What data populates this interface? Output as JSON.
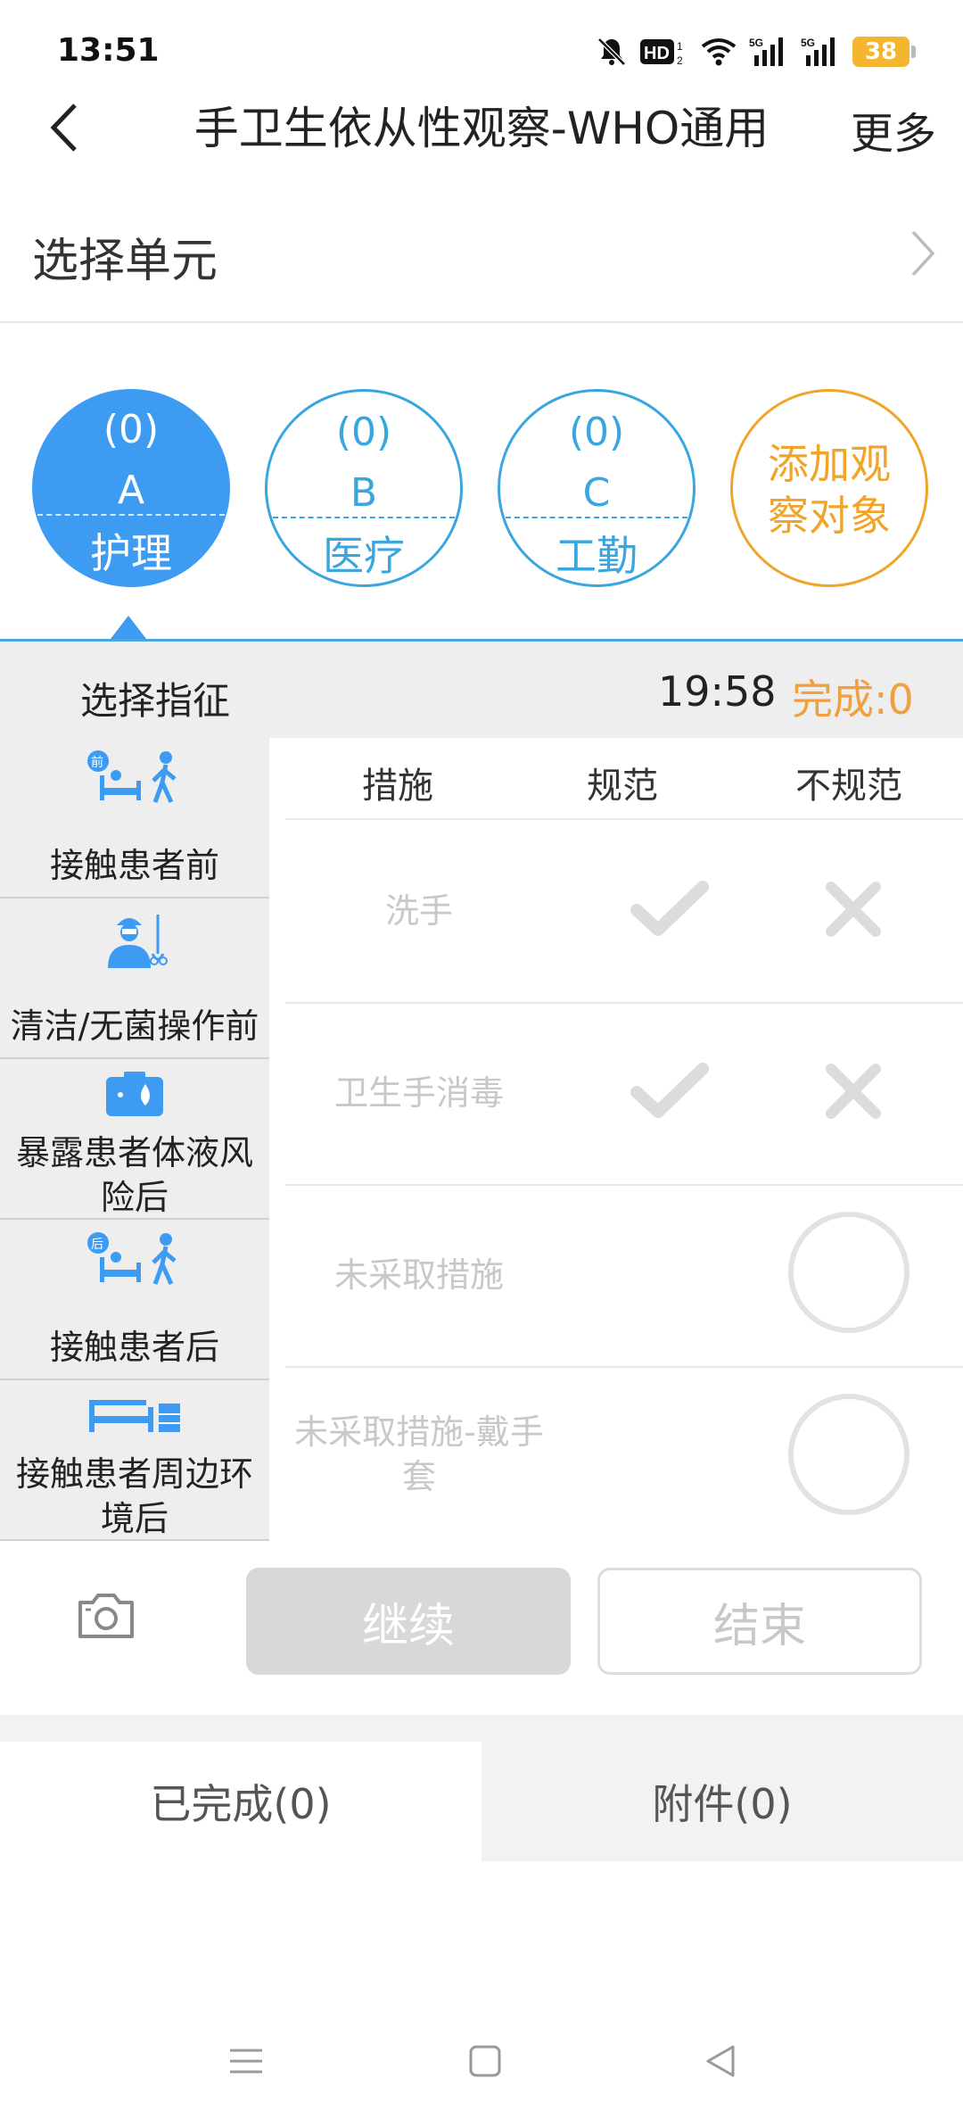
{
  "status_bar": {
    "time": "13:51",
    "icons": [
      "mute-bell-icon",
      "hd-icon",
      "wifi-icon",
      "signal-5g-icon",
      "signal-5g-icon"
    ],
    "battery": "38"
  },
  "nav": {
    "title": "手卫生依从性观察-WHO通用",
    "more_label": "更多"
  },
  "unit": {
    "label": "选择单元"
  },
  "subjects": [
    {
      "count": "(0)",
      "letter": "A",
      "role": "护理",
      "active": true
    },
    {
      "count": "(0)",
      "letter": "B",
      "role": "医疗",
      "active": false
    },
    {
      "count": "(0)",
      "letter": "C",
      "role": "工勤",
      "active": false
    }
  ],
  "add_subject_label": "添加观察对象",
  "indications": {
    "title": "选择指征",
    "timer": "19:58",
    "done": "完成:0",
    "items": [
      {
        "label": "接触患者前",
        "icon": "before-patient-icon"
      },
      {
        "label": "清洁/无菌操作前",
        "icon": "aseptic-procedure-icon"
      },
      {
        "label": "暴露患者体液风险后",
        "icon": "body-fluid-icon"
      },
      {
        "label": "接触患者后",
        "icon": "after-patient-icon"
      },
      {
        "label": "接触患者周边环境后",
        "icon": "patient-surroundings-icon"
      }
    ]
  },
  "measures": {
    "columns": [
      "措施",
      "规范",
      "不规范"
    ],
    "rows": [
      {
        "label": "洗手",
        "type": "check-cross"
      },
      {
        "label": "卫生手消毒",
        "type": "check-cross"
      },
      {
        "label": "未采取措施",
        "type": "ring"
      },
      {
        "label": "未采取措施-戴手套",
        "type": "ring"
      }
    ]
  },
  "actions": {
    "continue_label": "继续",
    "end_label": "结束"
  },
  "tabs": {
    "completed": "已完成(0)",
    "attachments": "附件(0)"
  },
  "colors": {
    "primary_blue": "#3d9cf2",
    "outline_blue": "#39a6df",
    "orange": "#f0a52a",
    "done_orange": "#f0a040"
  }
}
